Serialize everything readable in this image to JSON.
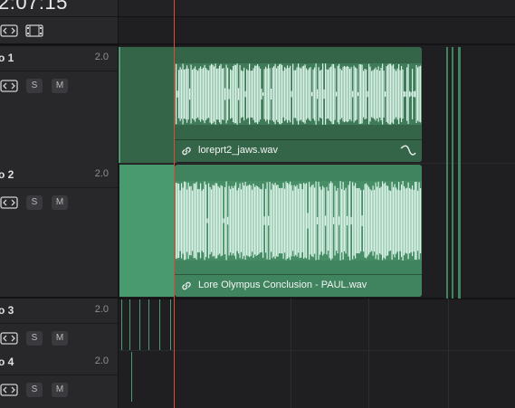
{
  "timecode": "2:07:15",
  "tracks": [
    {
      "name": "o 1",
      "volume": "2.0",
      "solo": "S",
      "mute": "M"
    },
    {
      "name": "o 2",
      "volume": "2.0",
      "solo": "S",
      "mute": "M"
    },
    {
      "name": "o 3",
      "volume": "2.0",
      "solo": "S",
      "mute": "M"
    },
    {
      "name": "o 4",
      "volume": "2.0",
      "solo": "S",
      "mute": "M"
    }
  ],
  "clips": [
    {
      "name": "loreprt2_jaws.wav"
    },
    {
      "name": "Lore Olympus Conclusion - PAUL.wav"
    }
  ],
  "colors": {
    "clip_green": "#3d7a5a",
    "clip_green_light": "#4f9a72",
    "waveform": "#d9f3e6",
    "playhead": "#e04a3a"
  },
  "icons": [
    "link-icon",
    "fade-curve-icon",
    "auto-select-icon",
    "filmstrip-icon"
  ]
}
